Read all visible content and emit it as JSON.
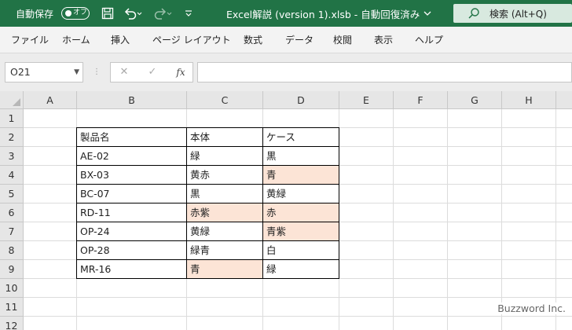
{
  "titlebar": {
    "autosave_label": "自動保存",
    "autosave_state": "オフ",
    "file_title": "Excel解説 (version 1).xlsb  -  自動回復済み",
    "search_placeholder": "検索 (Alt+Q)",
    "bg_color": "#217346"
  },
  "ribbon": {
    "tabs": [
      "ファイル",
      "ホーム",
      "挿入",
      "ページ レイアウト",
      "数式",
      "データ",
      "校閲",
      "表示",
      "ヘルプ"
    ]
  },
  "formula_bar": {
    "name_box": "O21",
    "fx_label": "fx",
    "formula": ""
  },
  "sheet": {
    "columns": [
      "A",
      "B",
      "C",
      "D",
      "E",
      "F",
      "G",
      "H"
    ],
    "rows": [
      "1",
      "2",
      "3",
      "4",
      "5",
      "6",
      "7",
      "8",
      "9",
      "10",
      "11",
      "12"
    ],
    "table": {
      "header": [
        "製品名",
        "本体",
        "ケース"
      ],
      "rows": [
        [
          "AE-02",
          "緑",
          "黒"
        ],
        [
          "BX-03",
          "黄赤",
          "青"
        ],
        [
          "BC-07",
          "黒",
          "黄緑"
        ],
        [
          "RD-11",
          "赤紫",
          "赤"
        ],
        [
          "OP-24",
          "黄緑",
          "青紫"
        ],
        [
          "OP-28",
          "緑青",
          "白"
        ],
        [
          "MR-16",
          "青",
          "緑"
        ]
      ],
      "highlighted_cells": [
        "D4",
        "C6",
        "D6",
        "D7",
        "C9"
      ],
      "highlight_color": "#fce4d6"
    }
  },
  "watermark": "Buzzword Inc."
}
